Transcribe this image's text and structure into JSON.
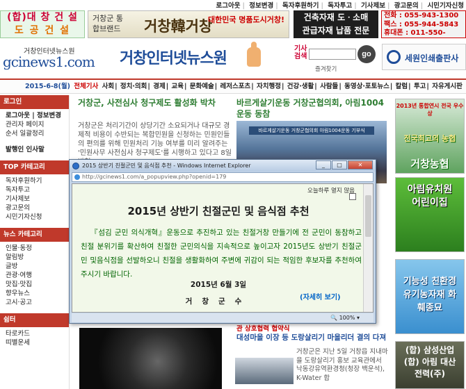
{
  "topnav": [
    "로그아웃",
    "정보변경",
    "독자후원하기",
    "독자투고",
    "기사제보",
    "광고문의",
    "시민기자신청"
  ],
  "ads": {
    "dfs": {
      "line1": "(합)대 창 건 설",
      "line2": "도 공 건 설"
    },
    "brand": {
      "line1": "거창군 통합브랜드",
      "logo": "거창韓거창",
      "line2": "대한민국 명품도시거창!"
    },
    "mat": {
      "line1": "건축자재 도ㆍ소매",
      "line2": "관급자재 납품 전문"
    },
    "phone": {
      "tel": "전화 : 055-943-1300",
      "fax": "팩스 : 055-944-5843",
      "mobile": "휴대폰 : 011-550-0608"
    },
    "print": "세원인쇄출판사"
  },
  "logo": {
    "small": "거창인터넷뉴스원",
    "main": "gcinews1.com",
    "title": "거창인터넷뉴스원"
  },
  "search": {
    "label": "기사검색",
    "button": "go",
    "bookmark": "즐겨찾기"
  },
  "catbar": {
    "date": "2015-6-8(월)",
    "all": "전체기사",
    "items": [
      "사회",
      "정치·의회",
      "경제",
      "교육",
      "문화예술",
      "레저스포츠",
      "자치행정",
      "건강·생활",
      "사람들",
      "동영상·포토뉴스",
      "칼럼",
      "투고",
      "자유게시판"
    ]
  },
  "left": {
    "login": {
      "title": "로그인",
      "items": [
        "로그아웃 | 정보변경",
        "관리자 페이지",
        "순서 일괄정리",
        "발행인 인사말"
      ]
    },
    "top": {
      "title": "TOP 카테고리",
      "items": [
        "독자후원하기",
        "독자투고",
        "기사제보",
        "광고문의",
        "시민기자신청"
      ]
    },
    "news": {
      "title": "뉴스 카테고리",
      "items": [
        "인물·동정",
        "알림방",
        "글방",
        "관광·여행",
        "맛집·맛집",
        "향우뉴스",
        "고시·공고"
      ]
    },
    "shelter": {
      "title": "쉼터",
      "items": [
        "타로카드",
        "띠별운세"
      ]
    }
  },
  "articles": {
    "h1": "거창군, 사전심사 청구제도 활성화 박차",
    "p1": "거창군은 처리기간이 상당기간 소요되거나 대규모 경제적 비용이 수반되는 복합민원을 신청하는 민원인들의 편의를 위해 민원처리 기능 여부를 미리 알려주는 '민원사무 사전심사 청구제도'를 시행하고 있다고 8일 밝혔",
    "h2": "바르게살기운동 거창군협의회, 아림1004 운동 동참",
    "photo_caption": "바르게살기운동 거창군협의회 아림1004운동 기부식",
    "h3": "관 상호협력 협약식",
    "h4": "대성마을 이장 등 도랑살리기 마을리더 결의 다져",
    "p2": "거창군은 지난 5일 거창읍 지내마을 도랑살리기 홍보 교육관에서 낙동강유역환경청(청장 백운석), K-Water 합"
  },
  "right": {
    "a1": {
      "top": "2013년 통합연시 전국 우수상",
      "mid": "전국최고의 농협",
      "bot": "거창농협"
    },
    "a2": "아림유치원 어린이집",
    "a3": "기능성 친환경 유기농자재 화훼종묘",
    "a4": "(합) 삼성산업 (합) 아림 대산전력(주)"
  },
  "popup": {
    "title": "2015 상반기 친절군민 및 음식점 추천 - Windows Internet Explorer",
    "url": "http://gcinews1.com/a_popupview.php?openid=179",
    "no_see": "오늘하루 열지 않음",
    "heading": "2015년 상반기 친절군민 및 음식점 추천",
    "body": "『섬김 군민 의식개혁』운동으로 추진하고 있는 친절거창 만들기에 전 군민이 동참하고 친절 분위기를 확산하여 친절한 군민의식을 지속적으로 높이고자 2015년도 상반기 친절군민 및음식점을 선발하오니 친절을 생활화하여 주변에 귀감이 되는 적임한 후보자를 추천하여 주시기 바랍니다.",
    "date": "2015년 6월 3일",
    "signer": "거창군수",
    "more": "(자세히 보기)",
    "zoom": "100%"
  },
  "colors": {
    "accent": "#c0392b",
    "link": "#1f4d99",
    "green": "#2e7d32"
  }
}
